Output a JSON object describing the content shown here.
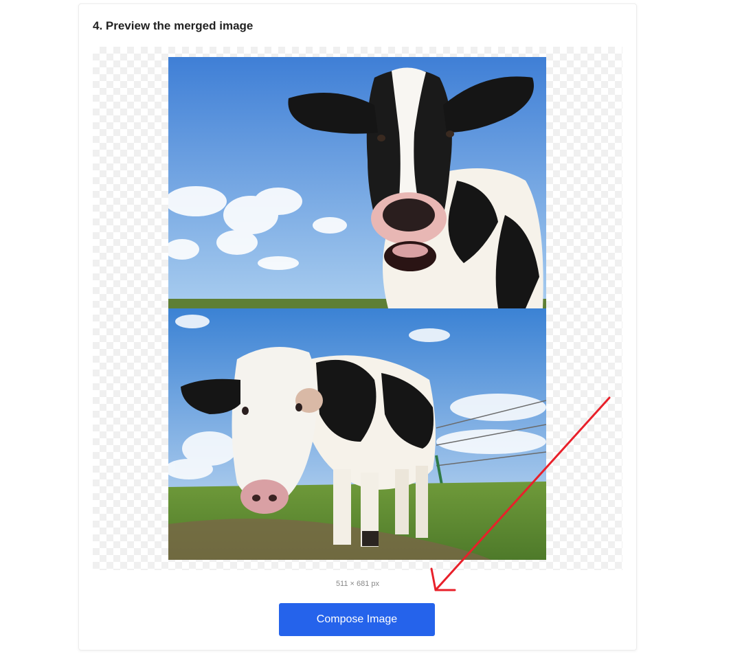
{
  "section": {
    "title": "4. Preview the merged image"
  },
  "preview": {
    "dimensions": "511 × 681 px",
    "top_photo": "cow-closeup-open-mouth",
    "bottom_photo": "cow-standing-in-pasture"
  },
  "actions": {
    "compose_label": "Compose Image"
  },
  "colors": {
    "button": "#2563eb",
    "annotation": "#e8202a"
  }
}
